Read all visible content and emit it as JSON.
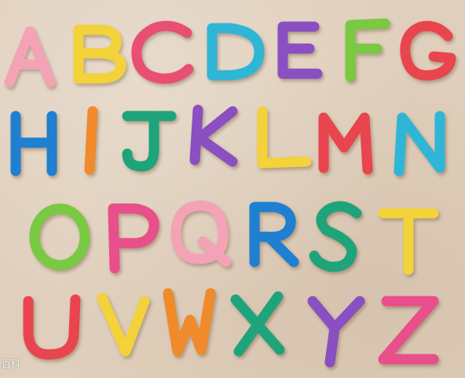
{
  "watermark": "百科",
  "letters": [
    {
      "char": "A",
      "color": "#f4a3b6"
    },
    {
      "char": "B",
      "color": "#f3d23a"
    },
    {
      "char": "C",
      "color": "#e94f73"
    },
    {
      "char": "D",
      "color": "#2fb6d6"
    },
    {
      "char": "E",
      "color": "#8a4fc1"
    },
    {
      "char": "F",
      "color": "#7ac943"
    },
    {
      "char": "G",
      "color": "#e8454f"
    },
    {
      "char": "H",
      "color": "#1f7fd0"
    },
    {
      "char": "I",
      "color": "#f08a2a"
    },
    {
      "char": "J",
      "color": "#1fa37a"
    },
    {
      "char": "K",
      "color": "#8a4fc1"
    },
    {
      "char": "L",
      "color": "#f3d23a"
    },
    {
      "char": "M",
      "color": "#e8454f"
    },
    {
      "char": "N",
      "color": "#2fb6d6"
    },
    {
      "char": "O",
      "color": "#7ac943"
    },
    {
      "char": "P",
      "color": "#e94f8a"
    },
    {
      "char": "Q",
      "color": "#f4a3b6"
    },
    {
      "char": "R",
      "color": "#1f7fd0"
    },
    {
      "char": "S",
      "color": "#1fa37a"
    },
    {
      "char": "T",
      "color": "#f3d23a"
    },
    {
      "char": "U",
      "color": "#e8454f"
    },
    {
      "char": "V",
      "color": "#f3d23a"
    },
    {
      "char": "W",
      "color": "#f08a2a"
    },
    {
      "char": "X",
      "color": "#1fa37a"
    },
    {
      "char": "Y",
      "color": "#8a4fc1"
    },
    {
      "char": "Z",
      "color": "#e94f8a"
    }
  ]
}
